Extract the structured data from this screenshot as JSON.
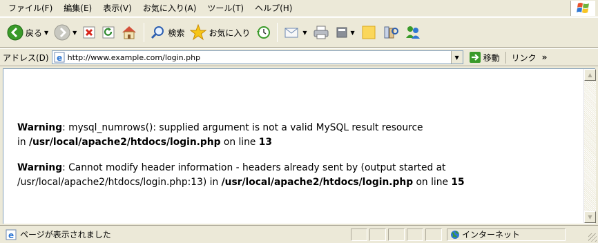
{
  "menubar": {
    "items": [
      "ファイル(F)",
      "編集(E)",
      "表示(V)",
      "お気に入り(A)",
      "ツール(T)",
      "ヘルプ(H)"
    ]
  },
  "toolbar": {
    "back_label": "戻る",
    "search_label": "検索",
    "favorites_label": "お気に入り"
  },
  "addressbar": {
    "label": "アドレス(D)",
    "url": "http://www.example.com/login.php",
    "go_label": "移動",
    "links_label": "リンク",
    "links_chevron": "»"
  },
  "content": {
    "warnings": [
      {
        "label": "Warning",
        "message": ": mysql_numrows(): supplied argument is not a valid MySQL result resource",
        "in_text": "in ",
        "path": "/usr/local/apache2/htdocs/login.php",
        "online_text": " on line ",
        "line": "13"
      },
      {
        "label": "Warning",
        "message": ": Cannot modify header information - headers already sent by (output started at /usr/local/apache2/htdocs/login.php:13) in ",
        "path": "/usr/local/apache2/htdocs/login.php",
        "online_text": " on line ",
        "line": "15"
      }
    ]
  },
  "statusbar": {
    "message": "ページが表示されました",
    "zone": "インターネット"
  },
  "colors": {
    "chrome": "#ece9d8",
    "content_bg": "#ffffff",
    "back_green": "#3a9a2a"
  }
}
